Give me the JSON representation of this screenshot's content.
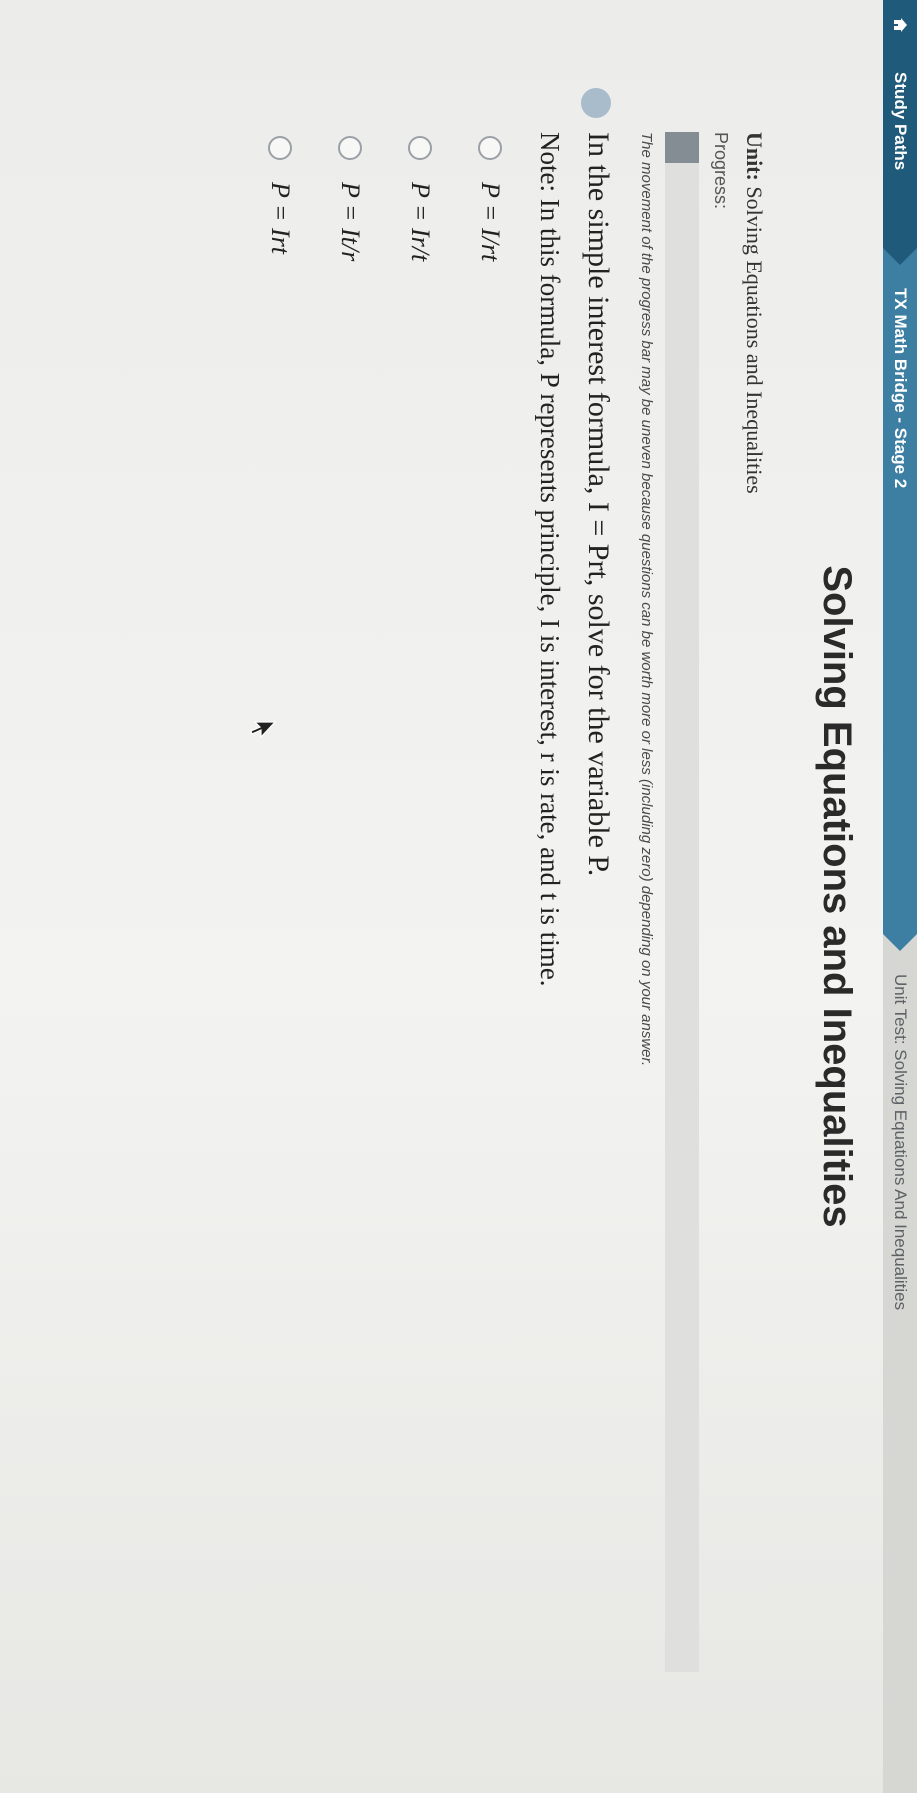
{
  "breadcrumb": {
    "home_icon": "home-icon",
    "study_paths": "Study Paths",
    "course": "TX Math Bridge - Stage 2",
    "current": "Unit Test: Solving Equations And Inequalities"
  },
  "title": "Solving Equations and Inequalities",
  "unit": {
    "label": "Unit:",
    "name": "Solving Equations and Inequalities"
  },
  "progress": {
    "label": "Progress:",
    "fraction": 0.02,
    "note": "The movement of the progress bar may be uneven because questions can be worth more or less (including zero) depending on your answer."
  },
  "question": {
    "text": "In the simple interest formula, I = Prt, solve for the variable P.",
    "note": "Note: In this formula, P represents principle, I is interest, r is rate, and t is time."
  },
  "choices": [
    "P = I/rt",
    "P = Ir/t",
    "P = It/r",
    "P = Irt"
  ],
  "colors": {
    "breadcrumb_dark": "#1f5a7a",
    "breadcrumb_mid": "#3c7fa3",
    "progress_fill": "#858d94"
  }
}
